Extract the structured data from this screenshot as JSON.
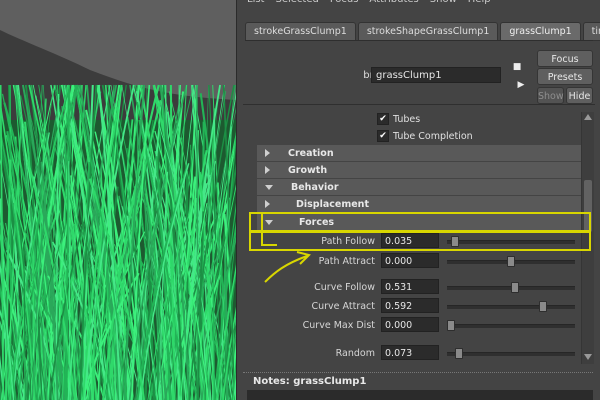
{
  "menubar": [
    "List",
    "Selected",
    "Focus",
    "Attributes",
    "Show",
    "Help"
  ],
  "tabs": [
    {
      "label": "strokeGrassClump1",
      "active": false
    },
    {
      "label": "strokeShapeGrassClump1",
      "active": false
    },
    {
      "label": "grassClump1",
      "active": true
    },
    {
      "label": "time1",
      "active": false
    }
  ],
  "brush": {
    "label": "brush:",
    "value": "grassClump1"
  },
  "buttons": {
    "focus": "Focus",
    "presets": "Presets",
    "show": "Show",
    "hide": "Hide"
  },
  "checkboxes": [
    {
      "label": "Tubes",
      "checked": true
    },
    {
      "label": "Tube Completion",
      "checked": true
    }
  ],
  "sections": {
    "creation": {
      "label": "Creation",
      "expanded": false
    },
    "growth": {
      "label": "Growth",
      "expanded": false
    },
    "behavior": {
      "label": "Behavior",
      "expanded": true
    },
    "displacement": {
      "label": "Displacement",
      "expanded": false
    },
    "forces": {
      "label": "Forces",
      "expanded": true
    }
  },
  "attributes": {
    "path_follow": {
      "label": "Path Follow",
      "value": "0.035",
      "slider": 0.03
    },
    "path_attract": {
      "label": "Path Attract",
      "value": "0.000",
      "slider": 0.5
    },
    "curve_follow": {
      "label": "Curve Follow",
      "value": "0.531",
      "slider": 0.53
    },
    "curve_attract": {
      "label": "Curve Attract",
      "value": "0.592",
      "slider": 0.77
    },
    "curve_max_dist": {
      "label": "Curve Max Dist",
      "value": "0.000",
      "slider": 0.0
    },
    "random": {
      "label": "Random",
      "value": "0.073",
      "slider": 0.07
    }
  },
  "notes": {
    "label": "Notes:  grassClump1"
  },
  "colors": {
    "highlight": "#d8d600",
    "grass": "#2fd86a",
    "panel": "#444444"
  }
}
